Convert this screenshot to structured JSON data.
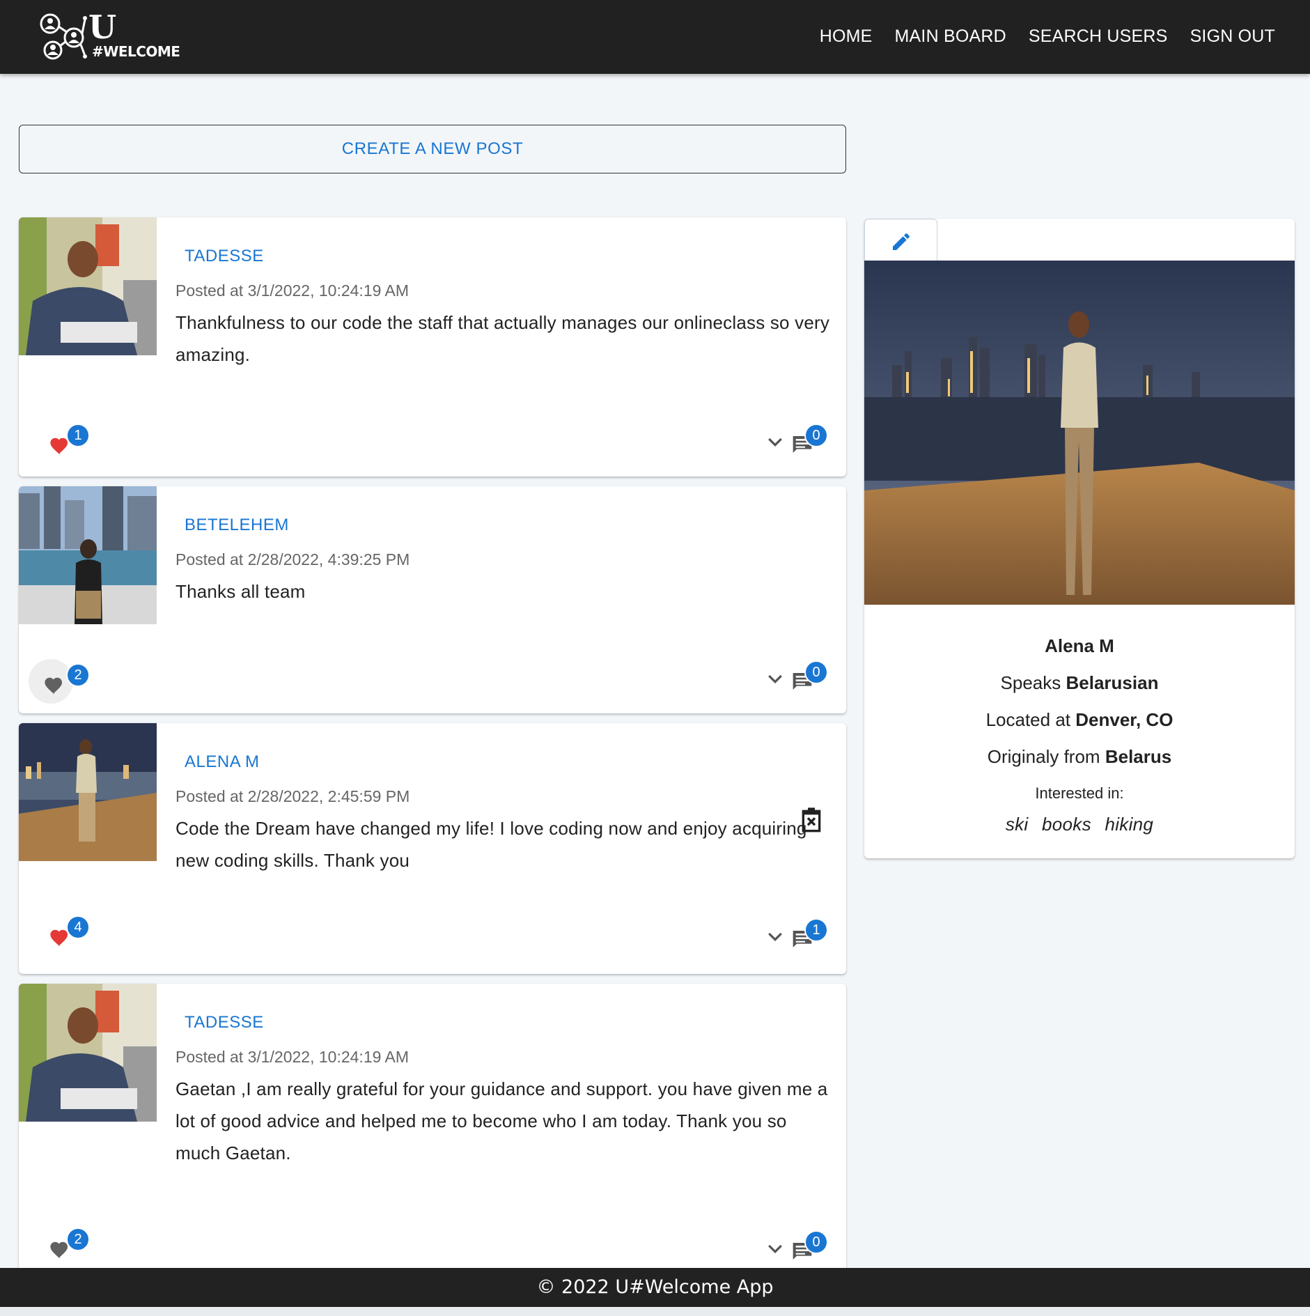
{
  "nav": {
    "brand_letter": "U",
    "brand_tag": "#WELCOME",
    "links": [
      "HOME",
      "MAIN BOARD",
      "SEARCH USERS",
      "SIGN OUT"
    ]
  },
  "create_post_label": "CREATE A NEW POST",
  "posts": [
    {
      "author": "TADESSE",
      "posted_at": "Posted at 3/1/2022, 10:24:19 AM",
      "text": "Thankfulness to our code the staff that actually manages our onlineclass so very amazing.",
      "likes": "1",
      "liked": true,
      "comments": "0",
      "deletable": false
    },
    {
      "author": "BETELEHEM",
      "posted_at": "Posted at 2/28/2022, 4:39:25 PM",
      "text": "Thanks all team",
      "likes": "2",
      "liked": false,
      "comments": "0",
      "deletable": false
    },
    {
      "author": "ALENA M",
      "posted_at": "Posted at 2/28/2022, 2:45:59 PM",
      "text": "Code the Dream have changed my life! I love coding now and enjoy acquiring new coding skills. Thank you",
      "likes": "4",
      "liked": true,
      "comments": "1",
      "deletable": true
    },
    {
      "author": "TADESSE",
      "posted_at": "Posted at 3/1/2022, 10:24:19 AM",
      "text": "Gaetan ,I am really grateful for your guidance and support. you have given me a lot of good advice and helped me to become who I am today. Thank you so much Gaetan.",
      "likes": "2",
      "liked": false,
      "comments": "0",
      "deletable": false
    }
  ],
  "profile": {
    "name": "Alena M",
    "speaks_prefix": "Speaks",
    "speaks": "Belarusian",
    "located_prefix": "Located at",
    "located": "Denver, CO",
    "origin_prefix": "Originaly from",
    "origin": "Belarus",
    "interests_label": "Interested in:",
    "interests": [
      "ski",
      "books",
      "hiking"
    ]
  },
  "footer": "© 2022 U#Welcome App",
  "colors": {
    "accent": "#1976d2",
    "like": "#e53935",
    "nav_bg": "#212121"
  }
}
